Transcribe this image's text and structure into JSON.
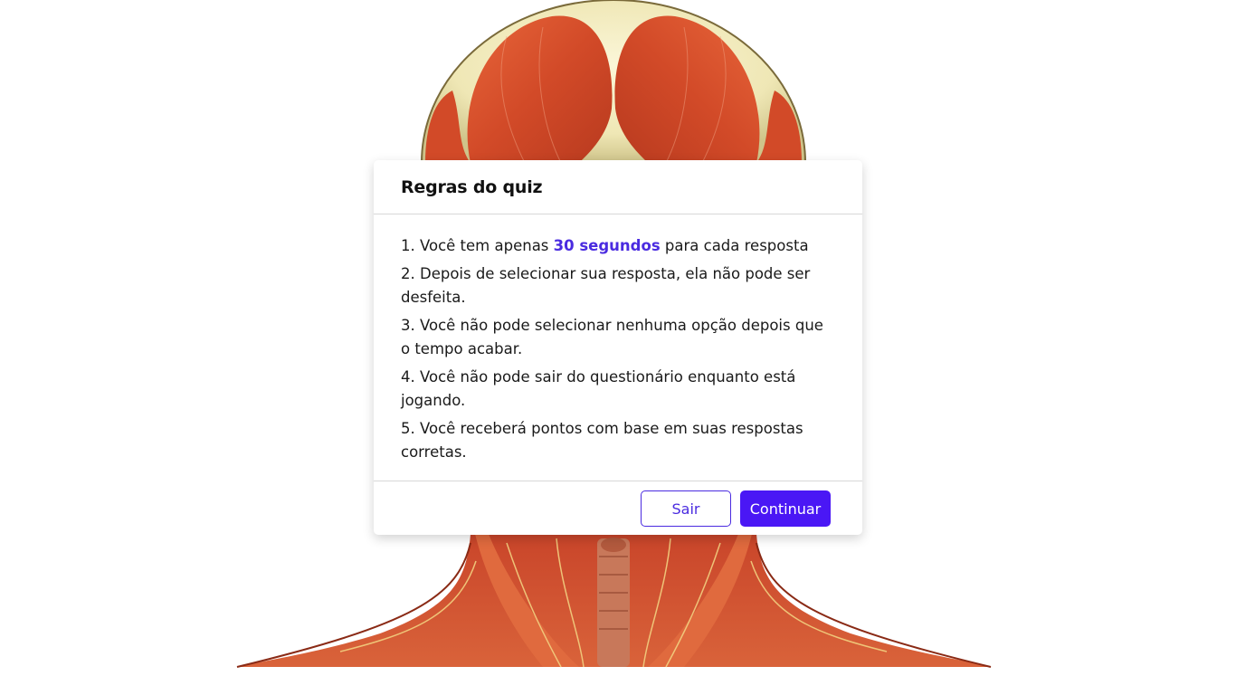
{
  "colors": {
    "accent": "#4a17f5",
    "highlight_text": "#4a2be0",
    "muscle": "#d5552e"
  },
  "background_image": {
    "icon": "anatomy-head-neck-muscles"
  },
  "dialog": {
    "title": "Regras do quiz",
    "rules": [
      {
        "prefix": "1. Você tem apenas ",
        "highlight": "30 segundos",
        "suffix": " para cada resposta"
      },
      {
        "prefix": "2. Depois de selecionar sua resposta, ela não pode ser desfeita.",
        "highlight": "",
        "suffix": ""
      },
      {
        "prefix": "3. Você não pode selecionar nenhuma opção depois que o tempo acabar.",
        "highlight": "",
        "suffix": ""
      },
      {
        "prefix": "4. Você não pode sair do questionário enquanto está jogando.",
        "highlight": "",
        "suffix": ""
      },
      {
        "prefix": "5. Você receberá pontos com base em suas respostas corretas.",
        "highlight": "",
        "suffix": ""
      }
    ],
    "buttons": {
      "quit": "Sair",
      "continue": "Continuar"
    }
  }
}
